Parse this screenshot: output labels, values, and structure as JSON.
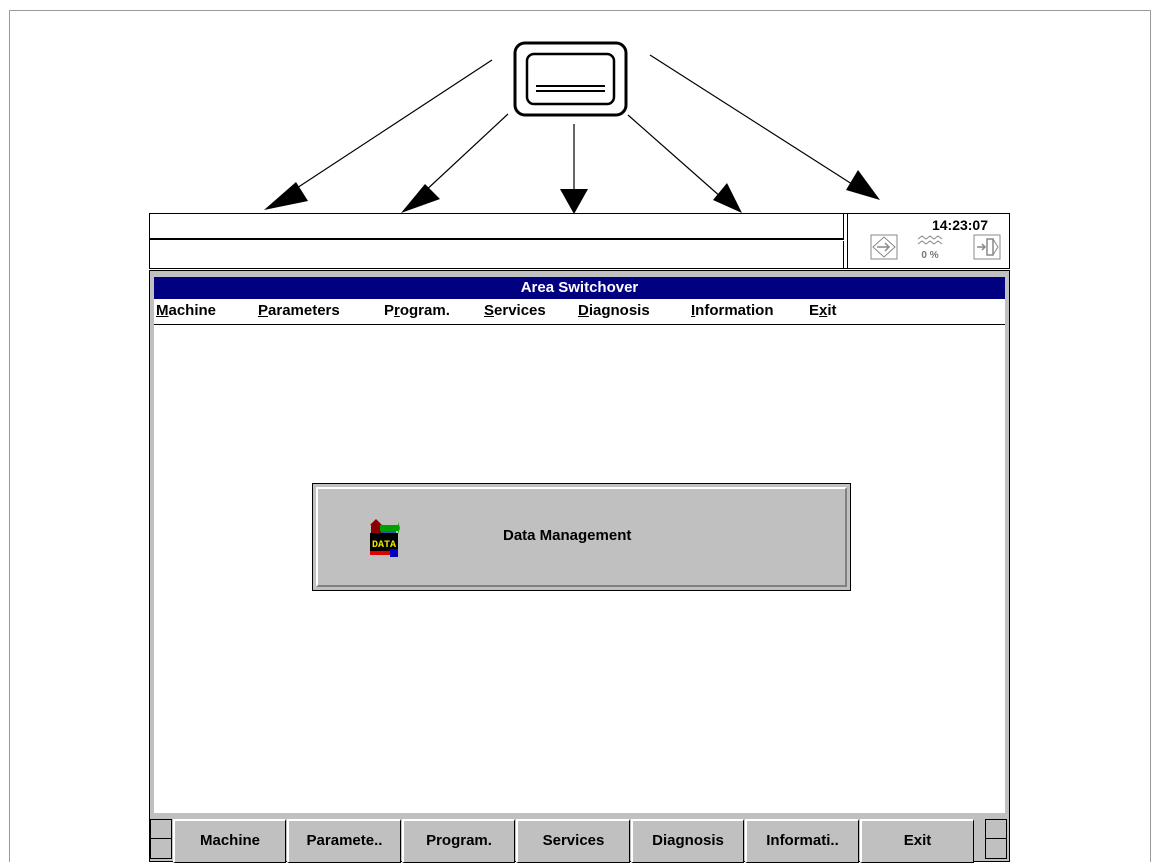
{
  "status": {
    "clock": "14:23:07",
    "icons": [
      "key-icon",
      "percent-gauge-icon",
      "exit-door-icon"
    ],
    "percent": "0 %"
  },
  "window": {
    "title": "Area Switchover",
    "title_color": "#000080"
  },
  "menu": {
    "items": [
      {
        "pre": "",
        "mnemonic": "M",
        "post": "achine"
      },
      {
        "pre": "",
        "mnemonic": "P",
        "post": "arameters"
      },
      {
        "pre": "P",
        "mnemonic": "r",
        "post": "ogram."
      },
      {
        "pre": "",
        "mnemonic": "S",
        "post": "ervices"
      },
      {
        "pre": "",
        "mnemonic": "D",
        "post": "iagnosis"
      },
      {
        "pre": "",
        "mnemonic": "I",
        "post": "nformation"
      },
      {
        "pre": "E",
        "mnemonic": "x",
        "post": "it"
      }
    ]
  },
  "main": {
    "data_management_label": "Data Management",
    "data_icon_text": "DATA"
  },
  "softkeys": [
    "Machine",
    "Paramete..",
    "Program.",
    "Services",
    "Diagnosis",
    "Informati..",
    "Exit"
  ],
  "colors": {
    "panel_gray": "#c0c0c0",
    "border": "#000000"
  }
}
